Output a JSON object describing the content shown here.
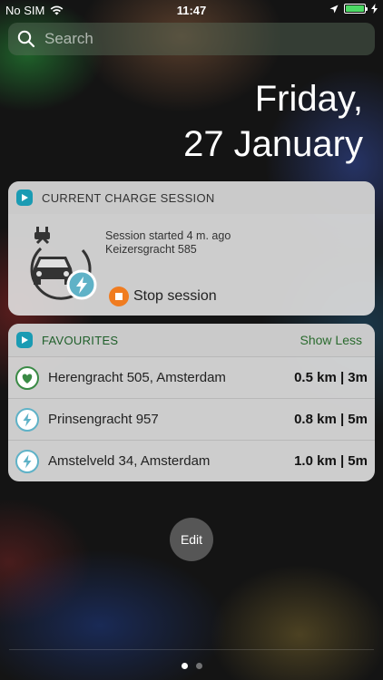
{
  "status_bar": {
    "carrier": "No SIM",
    "time": "11:47"
  },
  "search": {
    "placeholder": "Search"
  },
  "date": {
    "day": "Friday,",
    "date": "27 January"
  },
  "charge_session": {
    "title": "CURRENT CHARGE SESSION",
    "started": "Session started 4 m. ago",
    "location": "Keizersgracht 585",
    "stop_label": "Stop session"
  },
  "favourites": {
    "title": "FAVOURITES",
    "toggle_label": "Show Less",
    "items": [
      {
        "name": "Herengracht 505, Amsterdam",
        "distance": "0.5 km | 3m",
        "icon": "heart-icon"
      },
      {
        "name": "Prinsengracht 957",
        "distance": "0.8 km | 5m",
        "icon": "lightning-icon"
      },
      {
        "name": "Amstelveld 34, Amsterdam",
        "distance": "1.0 km | 5m",
        "icon": "lightning-icon"
      }
    ]
  },
  "edit_label": "Edit",
  "colors": {
    "accent": "#1a9bb3",
    "stop": "#f07c20",
    "link": "#2a6b2e",
    "battery": "#4cd964"
  },
  "page_dots": {
    "count": 2,
    "active": 1
  }
}
